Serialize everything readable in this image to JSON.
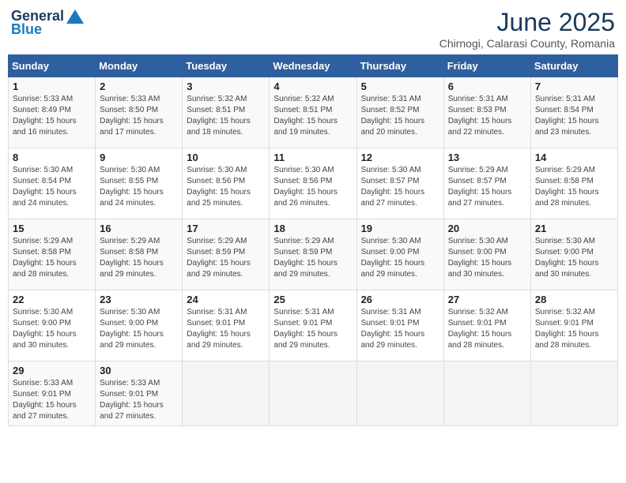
{
  "logo": {
    "general": "General",
    "blue": "Blue"
  },
  "title": "June 2025",
  "location": "Chirnogi, Calarasi County, Romania",
  "weekdays": [
    "Sunday",
    "Monday",
    "Tuesday",
    "Wednesday",
    "Thursday",
    "Friday",
    "Saturday"
  ],
  "weeks": [
    [
      {
        "day": "1",
        "info": "Sunrise: 5:33 AM\nSunset: 8:49 PM\nDaylight: 15 hours\nand 16 minutes."
      },
      {
        "day": "2",
        "info": "Sunrise: 5:33 AM\nSunset: 8:50 PM\nDaylight: 15 hours\nand 17 minutes."
      },
      {
        "day": "3",
        "info": "Sunrise: 5:32 AM\nSunset: 8:51 PM\nDaylight: 15 hours\nand 18 minutes."
      },
      {
        "day": "4",
        "info": "Sunrise: 5:32 AM\nSunset: 8:51 PM\nDaylight: 15 hours\nand 19 minutes."
      },
      {
        "day": "5",
        "info": "Sunrise: 5:31 AM\nSunset: 8:52 PM\nDaylight: 15 hours\nand 20 minutes."
      },
      {
        "day": "6",
        "info": "Sunrise: 5:31 AM\nSunset: 8:53 PM\nDaylight: 15 hours\nand 22 minutes."
      },
      {
        "day": "7",
        "info": "Sunrise: 5:31 AM\nSunset: 8:54 PM\nDaylight: 15 hours\nand 23 minutes."
      }
    ],
    [
      {
        "day": "8",
        "info": "Sunrise: 5:30 AM\nSunset: 8:54 PM\nDaylight: 15 hours\nand 24 minutes."
      },
      {
        "day": "9",
        "info": "Sunrise: 5:30 AM\nSunset: 8:55 PM\nDaylight: 15 hours\nand 24 minutes."
      },
      {
        "day": "10",
        "info": "Sunrise: 5:30 AM\nSunset: 8:56 PM\nDaylight: 15 hours\nand 25 minutes."
      },
      {
        "day": "11",
        "info": "Sunrise: 5:30 AM\nSunset: 8:56 PM\nDaylight: 15 hours\nand 26 minutes."
      },
      {
        "day": "12",
        "info": "Sunrise: 5:30 AM\nSunset: 8:57 PM\nDaylight: 15 hours\nand 27 minutes."
      },
      {
        "day": "13",
        "info": "Sunrise: 5:29 AM\nSunset: 8:57 PM\nDaylight: 15 hours\nand 27 minutes."
      },
      {
        "day": "14",
        "info": "Sunrise: 5:29 AM\nSunset: 8:58 PM\nDaylight: 15 hours\nand 28 minutes."
      }
    ],
    [
      {
        "day": "15",
        "info": "Sunrise: 5:29 AM\nSunset: 8:58 PM\nDaylight: 15 hours\nand 28 minutes."
      },
      {
        "day": "16",
        "info": "Sunrise: 5:29 AM\nSunset: 8:58 PM\nDaylight: 15 hours\nand 29 minutes."
      },
      {
        "day": "17",
        "info": "Sunrise: 5:29 AM\nSunset: 8:59 PM\nDaylight: 15 hours\nand 29 minutes."
      },
      {
        "day": "18",
        "info": "Sunrise: 5:29 AM\nSunset: 8:59 PM\nDaylight: 15 hours\nand 29 minutes."
      },
      {
        "day": "19",
        "info": "Sunrise: 5:30 AM\nSunset: 9:00 PM\nDaylight: 15 hours\nand 29 minutes."
      },
      {
        "day": "20",
        "info": "Sunrise: 5:30 AM\nSunset: 9:00 PM\nDaylight: 15 hours\nand 30 minutes."
      },
      {
        "day": "21",
        "info": "Sunrise: 5:30 AM\nSunset: 9:00 PM\nDaylight: 15 hours\nand 30 minutes."
      }
    ],
    [
      {
        "day": "22",
        "info": "Sunrise: 5:30 AM\nSunset: 9:00 PM\nDaylight: 15 hours\nand 30 minutes."
      },
      {
        "day": "23",
        "info": "Sunrise: 5:30 AM\nSunset: 9:00 PM\nDaylight: 15 hours\nand 29 minutes."
      },
      {
        "day": "24",
        "info": "Sunrise: 5:31 AM\nSunset: 9:01 PM\nDaylight: 15 hours\nand 29 minutes."
      },
      {
        "day": "25",
        "info": "Sunrise: 5:31 AM\nSunset: 9:01 PM\nDaylight: 15 hours\nand 29 minutes."
      },
      {
        "day": "26",
        "info": "Sunrise: 5:31 AM\nSunset: 9:01 PM\nDaylight: 15 hours\nand 29 minutes."
      },
      {
        "day": "27",
        "info": "Sunrise: 5:32 AM\nSunset: 9:01 PM\nDaylight: 15 hours\nand 28 minutes."
      },
      {
        "day": "28",
        "info": "Sunrise: 5:32 AM\nSunset: 9:01 PM\nDaylight: 15 hours\nand 28 minutes."
      }
    ],
    [
      {
        "day": "29",
        "info": "Sunrise: 5:33 AM\nSunset: 9:01 PM\nDaylight: 15 hours\nand 27 minutes."
      },
      {
        "day": "30",
        "info": "Sunrise: 5:33 AM\nSunset: 9:01 PM\nDaylight: 15 hours\nand 27 minutes."
      },
      null,
      null,
      null,
      null,
      null
    ]
  ]
}
